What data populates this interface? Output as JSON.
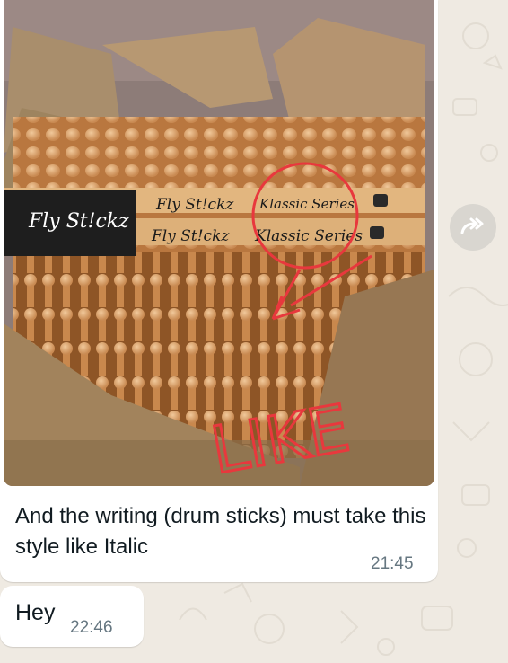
{
  "image_message": {
    "photo_description_icon": "photo",
    "brand_text": "Fly St!ckz",
    "series_text": "Klassic Series",
    "annotation_text": "LIKE",
    "caption": "And the writing (drum sticks) must take this style like Italic",
    "time": "21:45"
  },
  "text_message": {
    "text": "Hey",
    "time": "22:46"
  },
  "forward_button": {
    "icon": "forward-icon"
  },
  "colors": {
    "wallpaper": "#efeae2",
    "bubble": "#ffffff",
    "annotation": "#e8383d",
    "timestamp": "#667781"
  }
}
